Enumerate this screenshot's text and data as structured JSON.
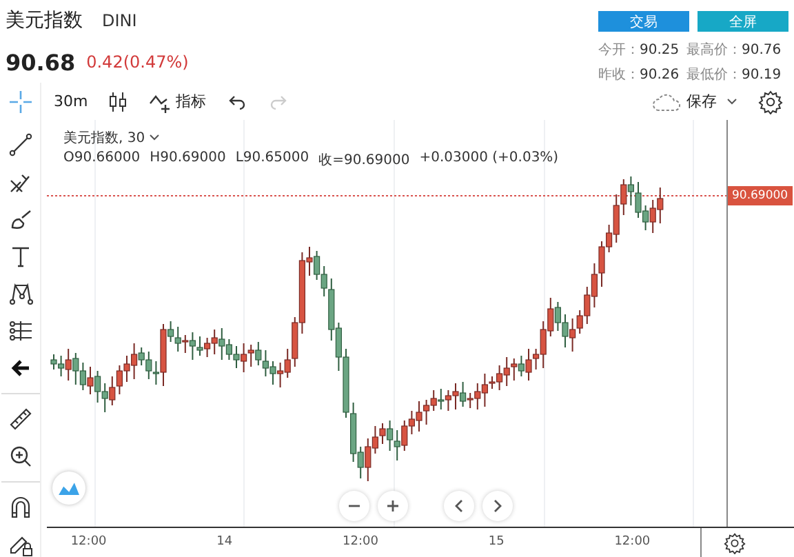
{
  "header": {
    "title": "美元指数",
    "symbol": "DINI",
    "price": "90.68",
    "change": "0.42(0.47%)",
    "buttons": [
      "交易",
      "全屏"
    ],
    "stats": [
      {
        "label": "今开：",
        "value": "90.25"
      },
      {
        "label": "最高价：",
        "value": "90.76"
      },
      {
        "label": "昨收：",
        "value": "90.26"
      },
      {
        "label": "最低价：",
        "value": "90.19"
      }
    ]
  },
  "toolbar": {
    "interval": "30m",
    "indicators": "指标",
    "redo_disabled": true,
    "save": "保存"
  },
  "chart": {
    "legend_title": "美元指数, 30",
    "ohlc": [
      "O90.66000",
      "H90.69000",
      "L90.65000",
      "收=90.69000",
      "+0.03000 (+0.03%)"
    ],
    "last_price": "90.69000",
    "time_labels": [
      "12:00",
      "14",
      "12:00",
      "15",
      "12:00"
    ]
  }
}
